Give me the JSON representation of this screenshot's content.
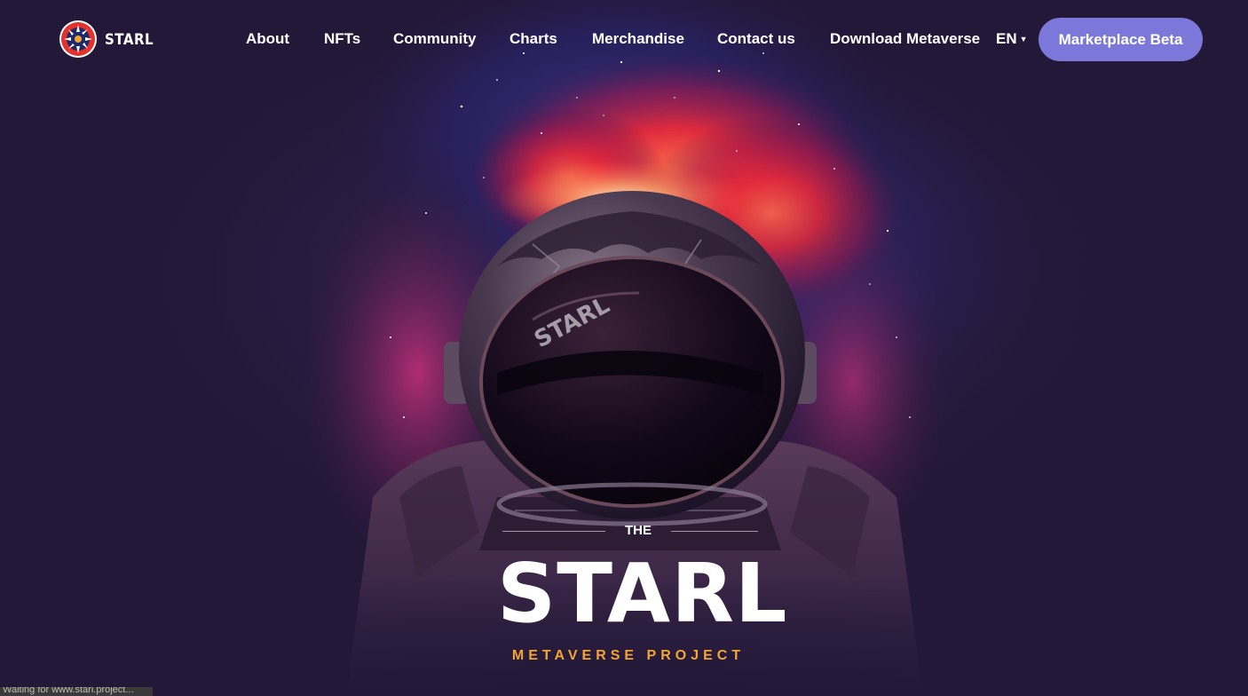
{
  "brand": {
    "name": "STARL",
    "logo_icon": "starl-emblem-icon",
    "accent_color": "#7b78d9",
    "gold_color": "#f2a531",
    "background_color": "#231838"
  },
  "nav": {
    "items": [
      {
        "label": "About"
      },
      {
        "label": "NFTs"
      },
      {
        "label": "Community"
      },
      {
        "label": "Charts"
      },
      {
        "label": "Merchandise"
      },
      {
        "label": "Contact us"
      },
      {
        "label": "Download Metaverse"
      }
    ],
    "language": {
      "label": "EN",
      "icon": "chevron-down-icon"
    },
    "cta_label": "Marketplace Beta"
  },
  "hero": {
    "pre_title": "THE",
    "title": "STARL",
    "subtitle": "METAVERSE PROJECT",
    "helmet_text": "STARL"
  },
  "status_bar": {
    "text": "Waiting for www.starl.project..."
  }
}
